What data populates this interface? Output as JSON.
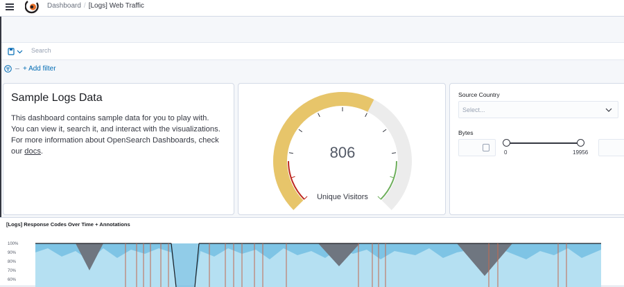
{
  "breadcrumbs": {
    "root": "Dashboard",
    "current": "[Logs] Web Traffic"
  },
  "search": {
    "placeholder": "Search"
  },
  "filters": {
    "add_filter": "+ Add filter"
  },
  "markdown": {
    "title": "Sample Logs Data",
    "body": "This dashboard contains sample data for you to play with. You can view it, search it, and interact with the visualizations. For more information about OpenSearch Dashboards, check our ",
    "link": "docs",
    "after": "."
  },
  "gauge": {
    "value": "806",
    "label": "Unique Visitors",
    "fraction": 0.6,
    "colors": {
      "fill": "#e7c56a",
      "track": "#ececec",
      "low": "#bd271e",
      "high": "#6dae5b"
    }
  },
  "controls": {
    "source_country": {
      "label": "Source Country",
      "placeholder": "Select..."
    },
    "bytes": {
      "label": "Bytes",
      "min": "0",
      "max": "19956"
    }
  },
  "chart_data": {
    "type": "area",
    "title": "[Logs] Response Codes Over Time + Annotations",
    "yticks": [
      "100%",
      "90%",
      "80%",
      "70%",
      "60%"
    ],
    "ylim": [
      60,
      100
    ],
    "series": [],
    "colors": {
      "light": "#b5e0f2",
      "mid": "#6cbbe0",
      "dark": "#6f7680",
      "annotation": "#c4694e"
    }
  }
}
